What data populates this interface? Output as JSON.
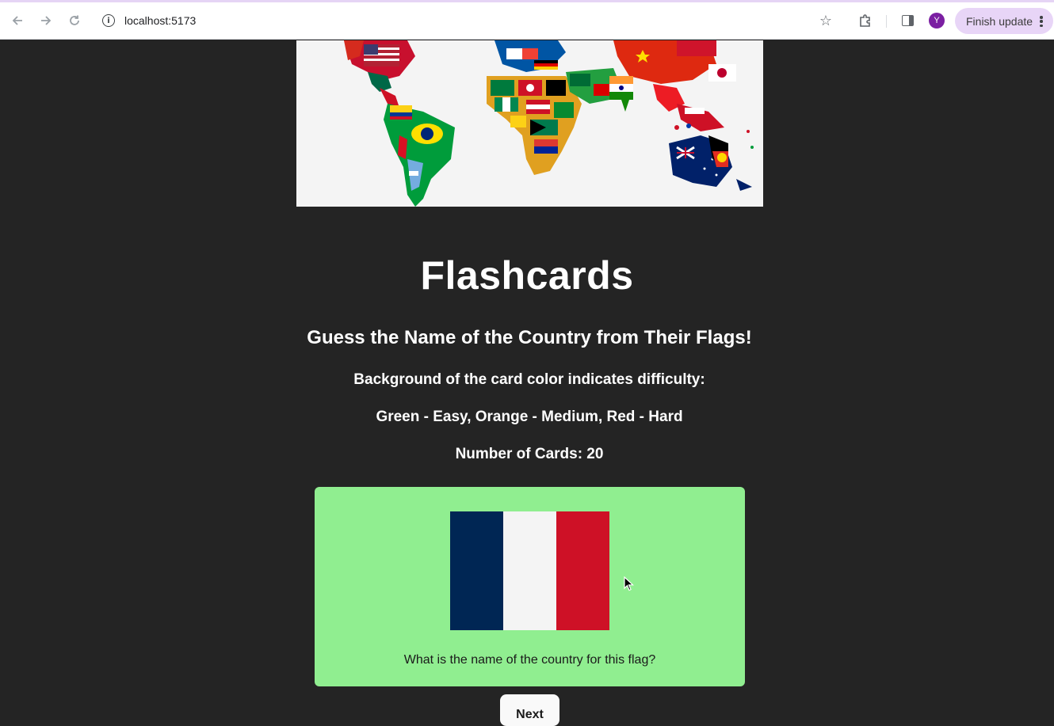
{
  "browser": {
    "url": "localhost:5173",
    "avatar_initial": "Y",
    "update_label": "Finish update"
  },
  "page": {
    "title": "Flashcards",
    "subtitle": "Guess the Name of the Country from Their Flags!",
    "info_lines": [
      "Background of the card color indicates difficulty:",
      "Green - Easy, Orange - Medium, Red - Hard",
      "Number of Cards: 20"
    ],
    "card": {
      "difficulty_color": "#90ee90",
      "flag_colors": [
        "#002654",
        "#f4f4f4",
        "#ce1126"
      ],
      "question": "What is the name of the country for this flag?"
    },
    "next_label": "Next"
  }
}
